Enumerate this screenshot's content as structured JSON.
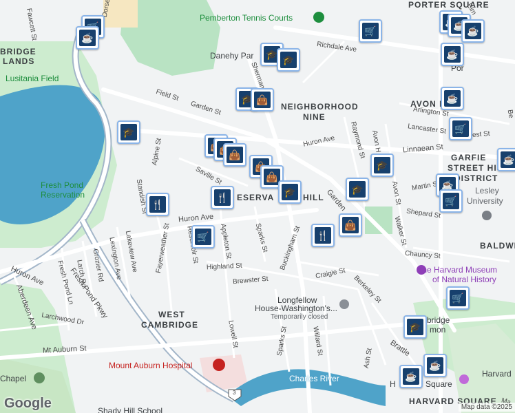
{
  "map": {
    "google_logo": "Google",
    "attribution": "Map data ©2025"
  },
  "districts": {
    "porter_square": "PORTER SQUARE",
    "avon_hill": "AVON HILL",
    "neighborhood": "NEIGHBORHOOD",
    "nine": "NINE",
    "garfield_street": "GARFIE",
    "street_his": "STREET HIS",
    "district": "DISTRICT",
    "bridge": "BRIDGE",
    "lands": "LANDS",
    "reservoir_hill_a": "ESERVA",
    "reservoir_hill_b": "HILL",
    "west": "WEST",
    "cambridge": "CAMBRIDGE",
    "baldwin": "BALDWI",
    "harvard_square": "HARVARD SQUARE",
    "harvard_sq_partial": "H",
    "harvard_sq_partial2": "Square"
  },
  "pois": {
    "pemberton": "Pemberton Tennis Courts",
    "daneby": "Danehy Par",
    "lusitania": "Lusitania Field",
    "fresh_pond_1": "Fresh Pond",
    "fresh_pond_2": "Reservation",
    "lesley_1": "Lesley",
    "lesley_2": "University",
    "harvard_museum_1": "The Harvard Museum",
    "harvard_museum_2": "of Natural History",
    "longfellow_1": "Longfellow",
    "longfellow_2": "House-Washington's...",
    "longfellow_3": "Temporarily closed",
    "cambridge_common_1": "bridge",
    "cambridge_common_2": "mon",
    "mount_auburn": "Mount Auburn Hospital",
    "charles_river": "Charles River",
    "chapel": "Chapel",
    "shady_hill": "Shady Hill School",
    "harvard_right": "Harvard",
    "porter_partial": "Por"
  },
  "streets": {
    "richdale": "Richdale Ave",
    "field": "Field St",
    "garden": "Garden St",
    "arlington": "Arlington St",
    "lancaster": "Lancaster St",
    "linnaean": "Linnaean St",
    "huron_ave_top": "Huron Ave",
    "raymond": "Raymond St",
    "avon_st": "Avon St",
    "avon_hill_st": "Avon H",
    "walker": "Walker St",
    "martin": "Martin St",
    "shepard": "Shepard St",
    "chauncy": "Chauncy St",
    "alpine": "Alpine St",
    "saville": "Saville St",
    "standish": "Standish St",
    "huron_ave_mid": "Huron Ave",
    "huron_ave_left": "Huron Ave",
    "appleton": "Appleton St",
    "reservoir": "Reservoir St",
    "sparks_top": "Sparks St",
    "buckingham": "Buckingham St",
    "highland": "Highland St",
    "brewster": "Brewster St",
    "craigie": "Craigie St",
    "berkeley": "Berkeley St",
    "fayerweather": "Fayerweather St",
    "lakeview": "Lakeview Ave",
    "lexington": "Lexington Ave",
    "grozier": "Grozier Rd",
    "larch": "Larch Rd",
    "fresh_pond_ln": "Fresh Pond Ln",
    "fresh_pond_pkwy": "Fresh Pond Pkwy",
    "aberdeen": "Aberdeen Ave",
    "larchwood": "Larchwood Dr",
    "mt_auburn": "Mt Auburn St",
    "lowell": "Lowell St",
    "sparks_bottom": "Sparks St",
    "willard": "Willard St",
    "ash": "Ash St",
    "brattle": "Brattle",
    "fawcett": "Fawcett St",
    "dorset": "Dorset",
    "elm": "Elm",
    "sherman": "Sherman St",
    "west_st": "est St",
    "garden_lower": "Garden",
    "route3": "3",
    "mass_ave": "Ma",
    "be": "Be"
  },
  "markers": [
    {
      "icon": "coffee-icon",
      "glyph": "☕"
    },
    {
      "icon": "cart-icon",
      "glyph": "🛒"
    },
    {
      "icon": "school-icon",
      "glyph": "🎓"
    },
    {
      "icon": "bag-icon",
      "glyph": "👜"
    },
    {
      "icon": "restaurant-icon",
      "glyph": "🍴"
    }
  ],
  "colors": {
    "pin_fill": "#17406d",
    "pin_border": "#8ab4e8",
    "water": "#4fa3c9",
    "park": "#b9e3c3",
    "road": "#ffffff",
    "highway": "#a3b6c9"
  }
}
